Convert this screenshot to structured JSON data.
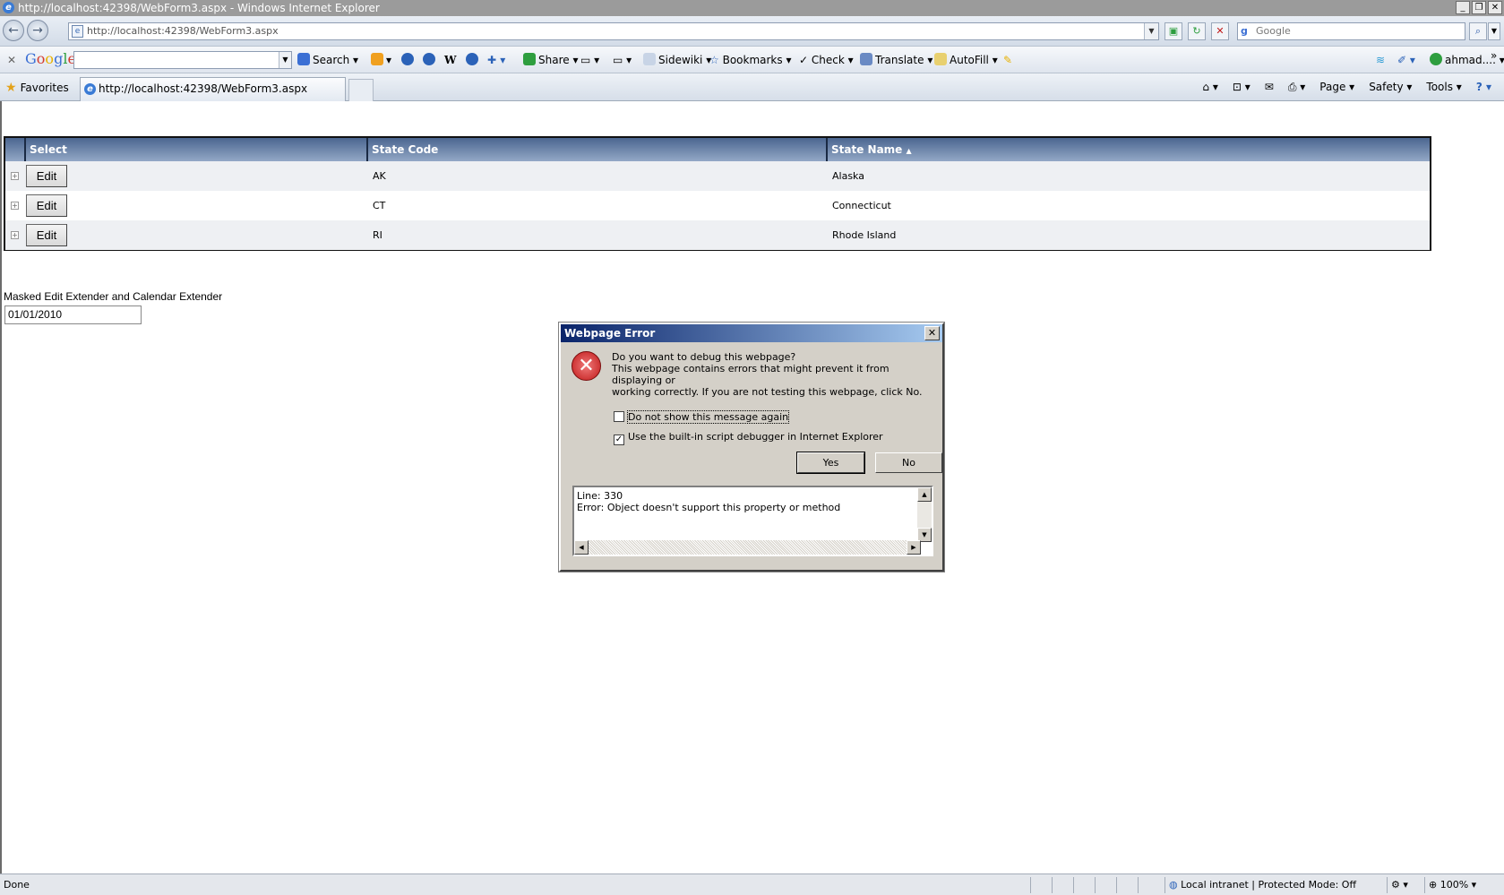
{
  "window": {
    "title": "http://localhost:42398/WebForm3.aspx - Windows Internet Explorer",
    "controls": [
      "_",
      "❐",
      "✕"
    ]
  },
  "address": {
    "url": "http://localhost:42398/WebForm3.aspx",
    "search_placeholder": "Google"
  },
  "google_toolbar": {
    "logo_letters": [
      "G",
      "o",
      "o",
      "g",
      "l",
      "e"
    ],
    "search": "Search",
    "share": "Share",
    "sidewiki": "Sidewiki",
    "bookmarks": "Bookmarks",
    "check": "Check",
    "translate": "Translate",
    "autofill": "AutoFill",
    "user": "ahmad...."
  },
  "favorites": {
    "label": "Favorites",
    "tab_title": "http://localhost:42398/WebForm3.aspx",
    "commands": [
      "Page",
      "Safety",
      "Tools"
    ]
  },
  "grid": {
    "headers": {
      "select": "Select",
      "code": "State Code",
      "name": "State Name",
      "sort_indicator": "▲"
    },
    "edit_label": "Edit",
    "rows": [
      {
        "code": "AK",
        "name": "Alaska"
      },
      {
        "code": "CT",
        "name": "Connecticut"
      },
      {
        "code": "RI",
        "name": "Rhode Island"
      }
    ]
  },
  "masked": {
    "label": "Masked Edit Extender and Calendar Extender",
    "value": "01/01/2010"
  },
  "dialog": {
    "title": "Webpage Error",
    "question": "Do you want to debug this webpage?",
    "message_line1": "This webpage contains errors that might prevent it from displaying or",
    "message_line2": "working correctly. If you are not testing this webpage, click No.",
    "checkbox1": "Do not show this message again",
    "checkbox1_checked": false,
    "checkbox2": "Use the built-in script debugger in Internet Explorer",
    "checkbox2_checked": true,
    "yes": "Yes",
    "no": "No",
    "error_line": "Line: 330",
    "error_text": "Error: Object doesn't support this property or method"
  },
  "status": {
    "text": "Done",
    "zone": "Local intranet | Protected Mode: Off",
    "zoom": "100%"
  }
}
